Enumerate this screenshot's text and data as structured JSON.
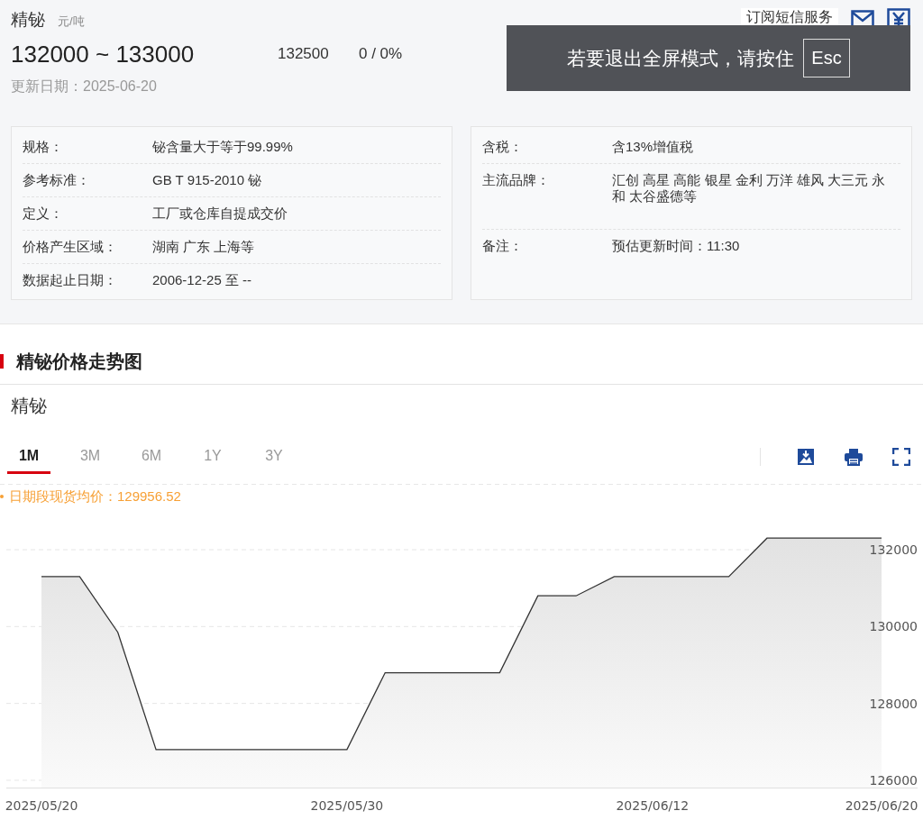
{
  "header": {
    "title": "精铋",
    "unit": "元/吨",
    "subscribe": "订阅短信服务",
    "price_range": "132000 ~ 133000",
    "average": "132500",
    "change": "0 / 0%",
    "update_date": "更新日期：2025-06-20"
  },
  "overlay": {
    "message": "若要退出全屏模式，请按住",
    "key": "Esc"
  },
  "info_left": [
    {
      "label": "规格：",
      "value": "铋含量大于等于99.99%"
    },
    {
      "label": "参考标准：",
      "value": "GB T 915-2010 铋"
    },
    {
      "label": "定义：",
      "value": "工厂或仓库自提成交价"
    },
    {
      "label": "价格产生区域：",
      "value": "湖南 广东 上海等"
    },
    {
      "label": "数据起止日期：",
      "value": "2006-12-25 至 --"
    }
  ],
  "info_right": [
    {
      "label": "含税：",
      "value": "含13%增值税"
    },
    {
      "label": "主流品牌：",
      "value": "汇创 高星 高能 银星 金利 万洋 雄风 大三元 永和 太谷盛德等"
    },
    {
      "label": "备注：",
      "value": "预估更新时间：11:30"
    }
  ],
  "section_title": "精铋价格走势图",
  "chart": {
    "title": "精铋",
    "ranges": [
      {
        "label": "1M",
        "selected": true
      },
      {
        "label": "3M",
        "selected": false
      },
      {
        "label": "6M",
        "selected": false
      },
      {
        "label": "1Y",
        "selected": false
      },
      {
        "label": "3Y",
        "selected": false
      }
    ],
    "legend": "日期段现货均价：129956.52",
    "chart_data": {
      "type": "area",
      "categories": [
        "2025/05/20",
        null,
        null,
        null,
        null,
        null,
        null,
        null,
        "2025/05/30",
        null,
        null,
        null,
        null,
        null,
        null,
        null,
        "2025/06/12",
        null,
        null,
        null,
        null,
        null,
        "2025/06/20"
      ],
      "grid": true,
      "ylim": [
        125800,
        133700
      ],
      "series": [
        {
          "color": "#333333",
          "values": [
            131300,
            131300,
            129850,
            126800,
            126800,
            126800,
            126800,
            126800,
            126800,
            128800,
            128800,
            128800,
            128800,
            130800,
            130800,
            131300,
            131300,
            131300,
            131300,
            132300,
            132300,
            132300,
            132300
          ]
        }
      ],
      "yticks": [
        126000,
        128000,
        130000,
        132000
      ]
    }
  }
}
